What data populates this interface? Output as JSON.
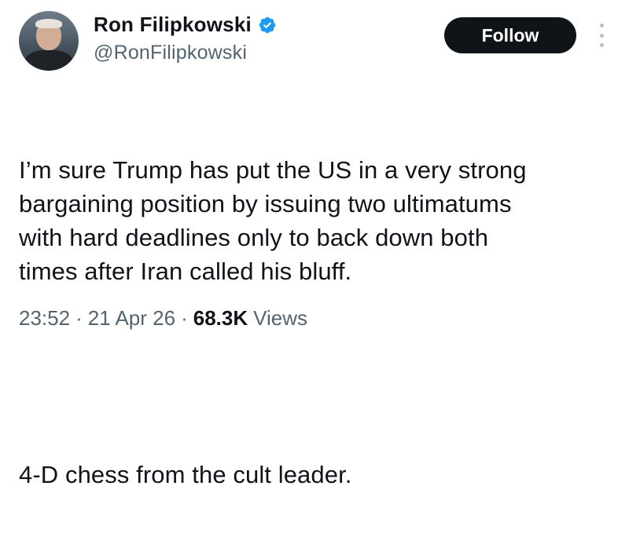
{
  "author": {
    "display_name": "Ron Filipkowski",
    "handle": "@RonFilipkowski",
    "verified": true,
    "verified_color": "#1d9bf0"
  },
  "follow_button": {
    "label": "Follow"
  },
  "tweet": {
    "paragraph_1": "I’m sure Trump has put the US in a very strong\nbargaining position by issuing two ultimatums\nwith hard deadlines only to back down both\ntimes after Iran called his bluff.",
    "paragraph_2": "4-D chess from the cult leader."
  },
  "meta": {
    "time": "23:52",
    "separator": "·",
    "date": "21 Apr 26",
    "views_count": "68.3K",
    "views_label": "Views"
  },
  "icons": {
    "more": "more-vertical-icon",
    "verified": "verified-badge-icon"
  }
}
